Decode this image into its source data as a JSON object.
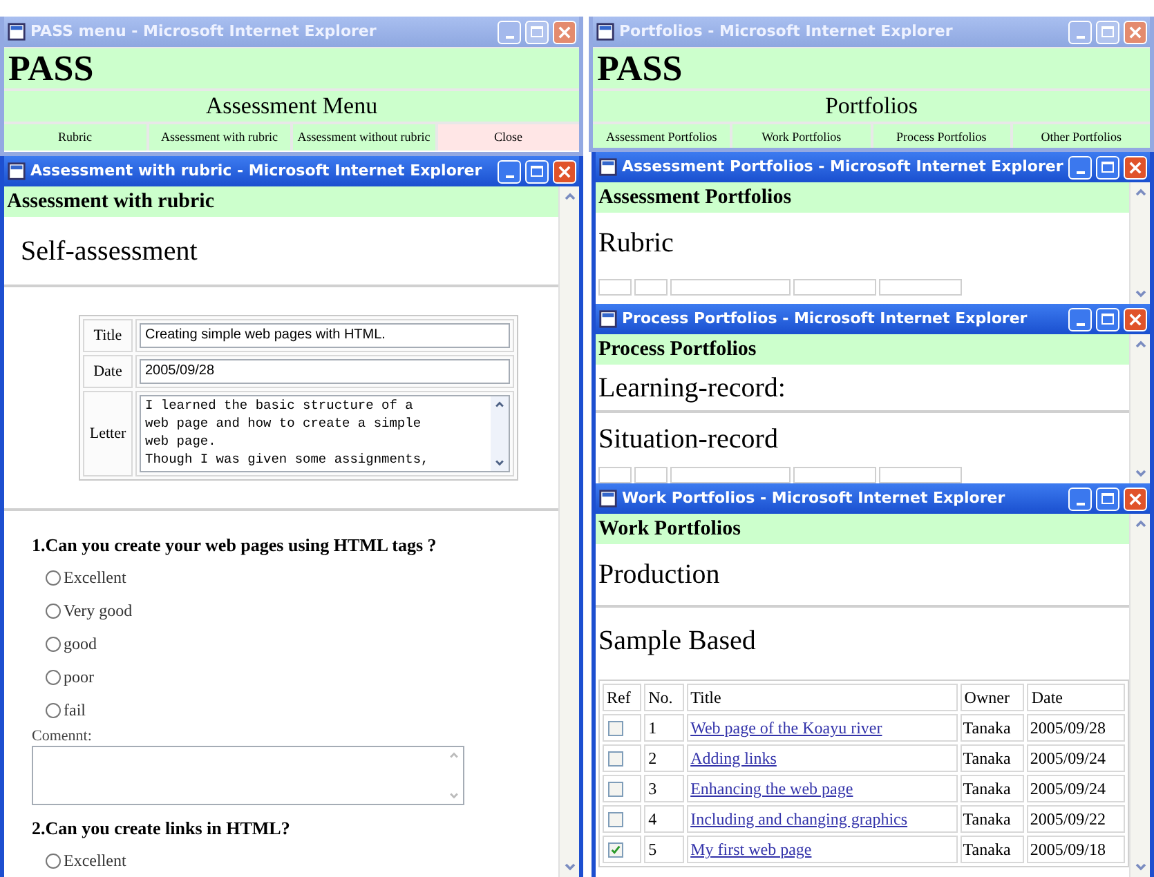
{
  "menu_window": {
    "title": "PASS menu - Microsoft Internet Explorer",
    "active": false,
    "brand": "PASS",
    "heading": "Assessment Menu",
    "links": [
      {
        "label": "Rubric",
        "kind": "link"
      },
      {
        "label": "Assessment with rubric",
        "kind": "link"
      },
      {
        "label": "Assessment without rubric",
        "kind": "link"
      },
      {
        "label": "Close",
        "kind": "close"
      }
    ]
  },
  "assessment_window": {
    "title": "Assessment with rubric - Microsoft Internet Explorer",
    "active": true,
    "header": "Assessment with rubric",
    "section": "Self-assessment",
    "form": [
      {
        "label": "Title",
        "kind": "text",
        "value": "Creating simple web pages with HTML."
      },
      {
        "label": "Date",
        "kind": "text",
        "value": "2005/09/28"
      },
      {
        "label": "Letter",
        "kind": "textarea",
        "value": "I learned the basic structure of a\nweb page and how to create a simple\nweb page.\nThough I was given some assignments,"
      }
    ],
    "questions": [
      {
        "text": "1.Can you create your web pages using HTML tags ?",
        "options": [
          {
            "label": "Excellent",
            "selected": false
          },
          {
            "label": "Very good",
            "selected": false
          },
          {
            "label": "good",
            "selected": false
          },
          {
            "label": "poor",
            "selected": false
          },
          {
            "label": "fail",
            "selected": false
          }
        ],
        "comment_label": "Comennt:"
      },
      {
        "text": "2.Can you create links in HTML?",
        "options": [
          {
            "label": "Excellent",
            "selected": false
          }
        ]
      }
    ]
  },
  "portfolios_window": {
    "title": "Portfolios - Microsoft Internet Explorer",
    "active": false,
    "brand": "PASS",
    "heading": "Portfolios",
    "links": [
      {
        "label": "Assessment Portfolios",
        "kind": "link"
      },
      {
        "label": "Work Portfolios",
        "kind": "link"
      },
      {
        "label": "Process Portfolios",
        "kind": "link"
      },
      {
        "label": "Other Portfolios",
        "kind": "link"
      }
    ]
  },
  "assessment_portfolios_window": {
    "title": "Assessment Portfolios - Microsoft Internet Explorer",
    "active": true,
    "header": "Assessment Portfolios",
    "blocks": [
      {
        "kind": "heading",
        "text": "Rubric"
      },
      {
        "kind": "cut_table"
      }
    ]
  },
  "process_portfolios_window": {
    "title": "Process Portfolios - Microsoft Internet Explorer",
    "active": true,
    "header": "Process Portfolios",
    "blocks": [
      {
        "kind": "heading",
        "text": "Learning-record:"
      },
      {
        "kind": "rule"
      },
      {
        "kind": "heading",
        "text": "Situation-record"
      },
      {
        "kind": "cut_table"
      }
    ]
  },
  "work_portfolios_window": {
    "title": "Work Portfolios - Microsoft Internet Explorer",
    "active": true,
    "header": "Work Portfolios",
    "blocks": [
      {
        "kind": "heading",
        "text": "Production"
      },
      {
        "kind": "rule"
      },
      {
        "kind": "heading",
        "text": "Sample Based"
      },
      {
        "kind": "table",
        "columns": [
          "Ref",
          "No.",
          "Title",
          "Owner",
          "Date"
        ],
        "rows": [
          {
            "checked": false,
            "no": "1",
            "title": "Web page of the Koayu river",
            "owner": "Tanaka",
            "date": "2005/09/28"
          },
          {
            "checked": false,
            "no": "2",
            "title": "Adding links",
            "owner": "Tanaka",
            "date": "2005/09/24"
          },
          {
            "checked": false,
            "no": "3",
            "title": "Enhancing the web page",
            "owner": "Tanaka",
            "date": "2005/09/24"
          },
          {
            "checked": false,
            "no": "4",
            "title": "Including and changing graphics",
            "owner": "Tanaka",
            "date": "2005/09/22"
          },
          {
            "checked": true,
            "no": "5",
            "title": "My first web page",
            "owner": "Tanaka",
            "date": "2005/09/18"
          }
        ]
      }
    ]
  }
}
